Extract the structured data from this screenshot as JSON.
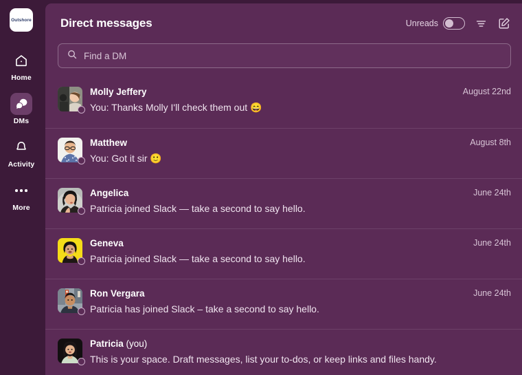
{
  "rail": {
    "workspace": {
      "name": "Outshore"
    },
    "items": [
      {
        "label": "Home",
        "icon": "home-icon",
        "active": false
      },
      {
        "label": "DMs",
        "icon": "dms-icon",
        "active": true
      },
      {
        "label": "Activity",
        "icon": "bell-icon",
        "active": false
      },
      {
        "label": "More",
        "icon": "ellipsis-icon",
        "active": false
      }
    ]
  },
  "header": {
    "title": "Direct messages",
    "unreads_label": "Unreads",
    "unreads_on": false,
    "filter_icon": "filter-icon",
    "compose_icon": "compose-icon"
  },
  "search": {
    "placeholder": "Find a DM",
    "value": "",
    "icon": "search-icon"
  },
  "dms": [
    {
      "name": "Molly Jeffery",
      "suffix": "",
      "preview": "You: Thanks Molly I'll check them out 😄",
      "date": "August 22nd",
      "presence": "offline"
    },
    {
      "name": "Matthew",
      "suffix": "",
      "preview": "You: Got it sir 🙂",
      "date": "August 8th",
      "presence": "offline"
    },
    {
      "name": "Angelica",
      "suffix": "",
      "preview": "Patricia joined Slack — take a second to say hello.",
      "date": "June 24th",
      "presence": "offline"
    },
    {
      "name": "Geneva",
      "suffix": "",
      "preview": "Patricia joined Slack — take a second to say hello.",
      "date": "June 24th",
      "presence": "offline"
    },
    {
      "name": "Ron Vergara",
      "suffix": "",
      "preview": "Patricia has joined Slack – take a second to say hello.",
      "date": "June 24th",
      "presence": "offline"
    },
    {
      "name": "Patricia",
      "suffix": " (you)",
      "preview": "This is your space. Draft messages, list your to-dos, or keep links and files handy.",
      "date": "",
      "presence": "offline"
    }
  ],
  "colors": {
    "rail_bg": "#3c1a39",
    "panel_bg": "#5b2b56",
    "divider": "#6d4169",
    "active_item": "#6c3e69",
    "text_primary": "#ffffff",
    "text_secondary": "#d8c5d6"
  }
}
